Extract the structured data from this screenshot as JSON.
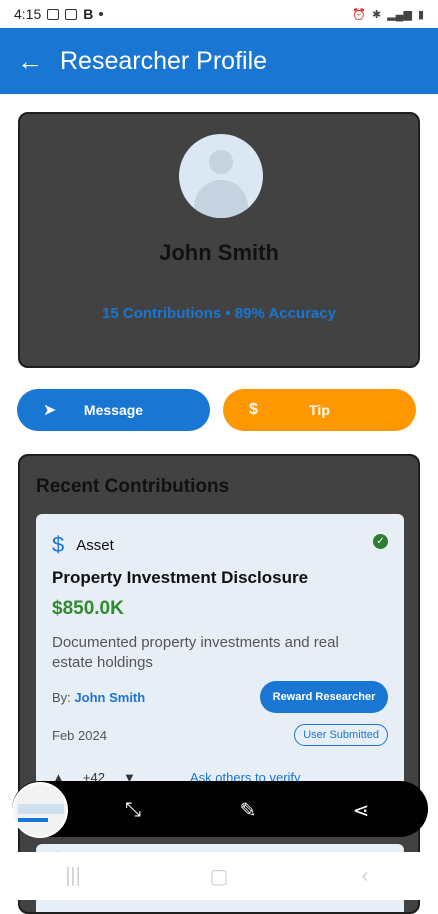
{
  "statusbar": {
    "time": "4:15",
    "letter": "B"
  },
  "appbar": {
    "title": "Researcher Profile"
  },
  "profile": {
    "name": "John Smith",
    "stats": "15 Contributions • 89% Accuracy"
  },
  "actions": {
    "message_label": "Message",
    "tip_label": "Tip"
  },
  "recent": {
    "title": "Recent Contributions",
    "item": {
      "type": "Asset",
      "title": "Property Investment Disclosure",
      "amount": "$850.0K",
      "description": "Documented property investments and real estate holdings",
      "by_label": "By:",
      "by_name": "John Smith",
      "reward_label": "Reward Researcher",
      "date": "Feb 2024",
      "status": "User Submitted",
      "votes": "+42",
      "verify_label": "Ask others to verify"
    }
  },
  "colors": {
    "primary": "#1976d2",
    "accent": "#ff9800",
    "amount": "#2e8b2e"
  }
}
